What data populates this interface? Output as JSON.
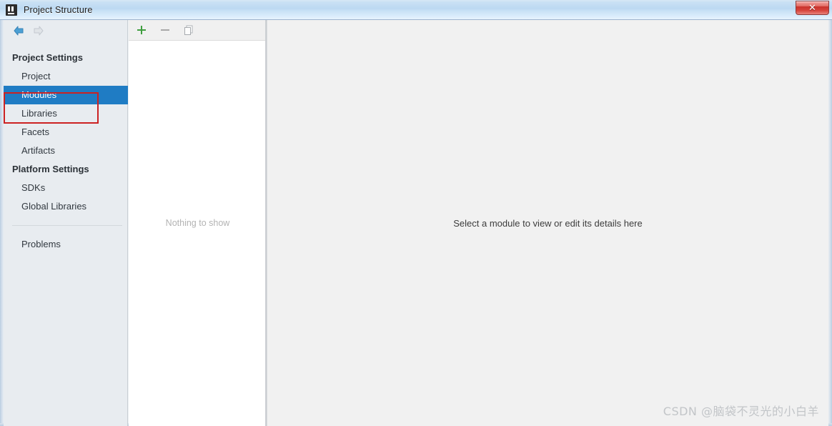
{
  "window": {
    "title": "Project Structure",
    "app_icon": "intellij-idea-icon",
    "close_label": "✕"
  },
  "sidebar": {
    "nav": {
      "back_icon": "back-arrow-icon",
      "forward_icon": "forward-arrow-icon"
    },
    "groups": [
      {
        "label": "Project Settings",
        "items": [
          {
            "label": "Project",
            "selected": false
          },
          {
            "label": "Modules",
            "selected": true
          },
          {
            "label": "Libraries",
            "selected": false
          },
          {
            "label": "Facets",
            "selected": false
          },
          {
            "label": "Artifacts",
            "selected": false
          }
        ]
      },
      {
        "label": "Platform Settings",
        "items": [
          {
            "label": "SDKs",
            "selected": false
          },
          {
            "label": "Global Libraries",
            "selected": false
          }
        ]
      }
    ],
    "footer_items": [
      {
        "label": "Problems",
        "selected": false
      }
    ]
  },
  "list_panel": {
    "toolbar": [
      {
        "name": "add-button",
        "label": "+",
        "color": "#3f9e3f"
      },
      {
        "name": "remove-button",
        "label": "−",
        "color": "#9a9a9a"
      },
      {
        "name": "copy-button",
        "label": "copy-icon",
        "color": "#9a9a9a"
      }
    ],
    "empty_text": "Nothing to show"
  },
  "detail_panel": {
    "message": "Select a module to view or edit its details here"
  },
  "annotation": {
    "color": "#cc2222",
    "target": "Modules"
  },
  "watermark": {
    "text": "CSDN @脑袋不灵光的小白羊"
  }
}
